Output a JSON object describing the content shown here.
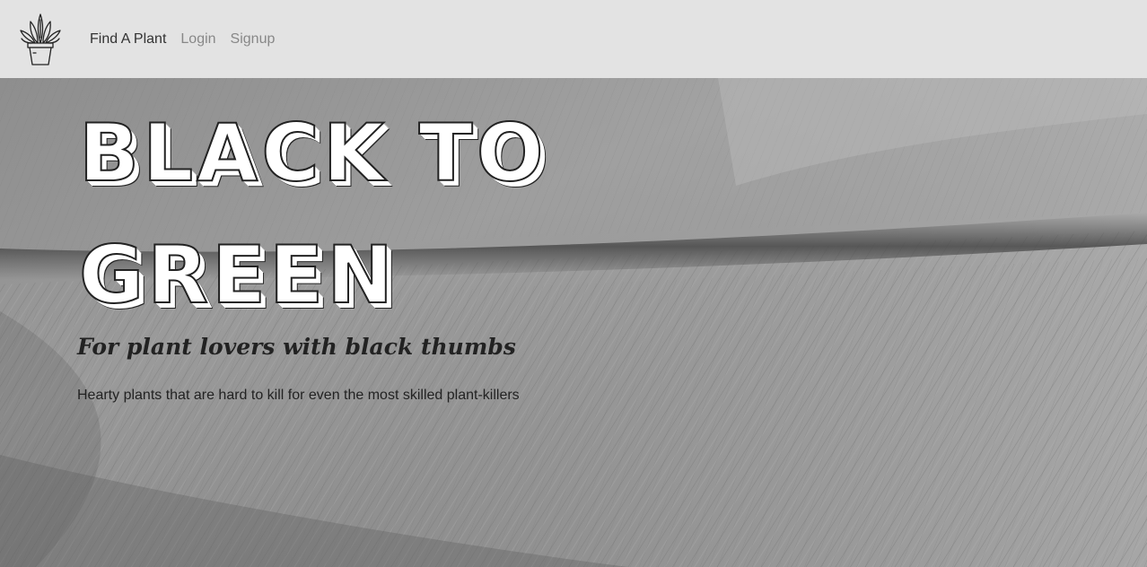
{
  "navbar": {
    "logo_icon": "potted-plant-icon",
    "links": [
      {
        "label": "Find A Plant",
        "active": true
      },
      {
        "label": "Login",
        "active": false
      },
      {
        "label": "Signup",
        "active": false
      }
    ],
    "background": "#e3e3e3"
  },
  "hero": {
    "title": "BLACK TO GREEN",
    "subtitle": "For plant lovers with black thumbs",
    "description": "Hearty plants that are hard to kill for even the most skilled plant-killers",
    "background_image": "leaf-texture-grayscale"
  }
}
